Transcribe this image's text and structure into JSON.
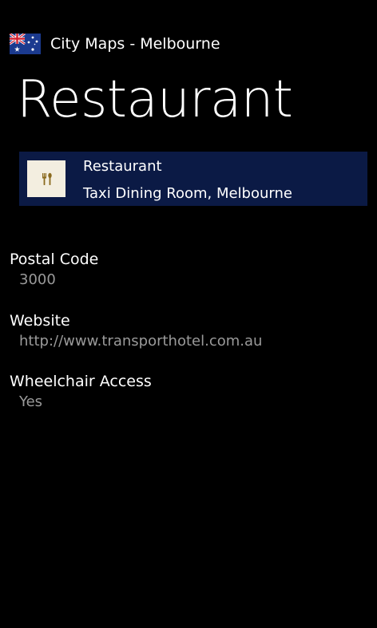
{
  "app": {
    "title": "City Maps - Melbourne",
    "flag_icon": "australia-flag-icon"
  },
  "page": {
    "title": "Restaurant"
  },
  "poi": {
    "icon": "restaurant-icon",
    "category": "Restaurant",
    "name": "Taxi Dining Room, Melbourne",
    "card_color": "#0b1a45",
    "icon_bg": "#f3eee0"
  },
  "details": [
    {
      "label": "Postal Code",
      "value": "3000"
    },
    {
      "label": "Website",
      "value": "http://www.transporthotel.com.au"
    },
    {
      "label": "Wheelchair Access",
      "value": "Yes"
    }
  ],
  "colors": {
    "background": "#000000",
    "label": "#ffffff",
    "value": "#9a9a9a"
  }
}
